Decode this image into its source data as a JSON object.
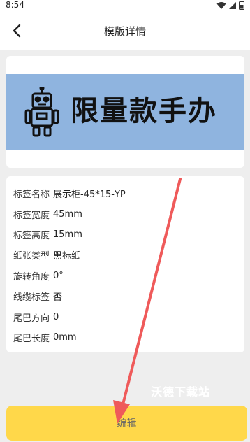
{
  "status_bar": {
    "time": "8:54",
    "icons": [
      "wifi-icon",
      "signal-icon",
      "battery-icon"
    ]
  },
  "header": {
    "title": "模版详情",
    "back_icon": "chevron-left-icon"
  },
  "preview": {
    "label_text": "限量款手办",
    "background_color": "#8fb4df"
  },
  "details": [
    {
      "key": "标签名称",
      "value": "展示柜-45*15-YP"
    },
    {
      "key": "标签宽度",
      "value": "45mm"
    },
    {
      "key": "标签高度",
      "value": "15mm"
    },
    {
      "key": "纸张类型",
      "value": "黑标纸"
    },
    {
      "key": "旋转角度",
      "value": "0°"
    },
    {
      "key": "线缆标签",
      "value": "否"
    },
    {
      "key": "尾巴方向",
      "value": "0"
    },
    {
      "key": "尾巴长度",
      "value": "0mm"
    }
  ],
  "watermark": "沃德下载站",
  "edit_button": {
    "label": "编辑",
    "color": "#ffd84a"
  }
}
